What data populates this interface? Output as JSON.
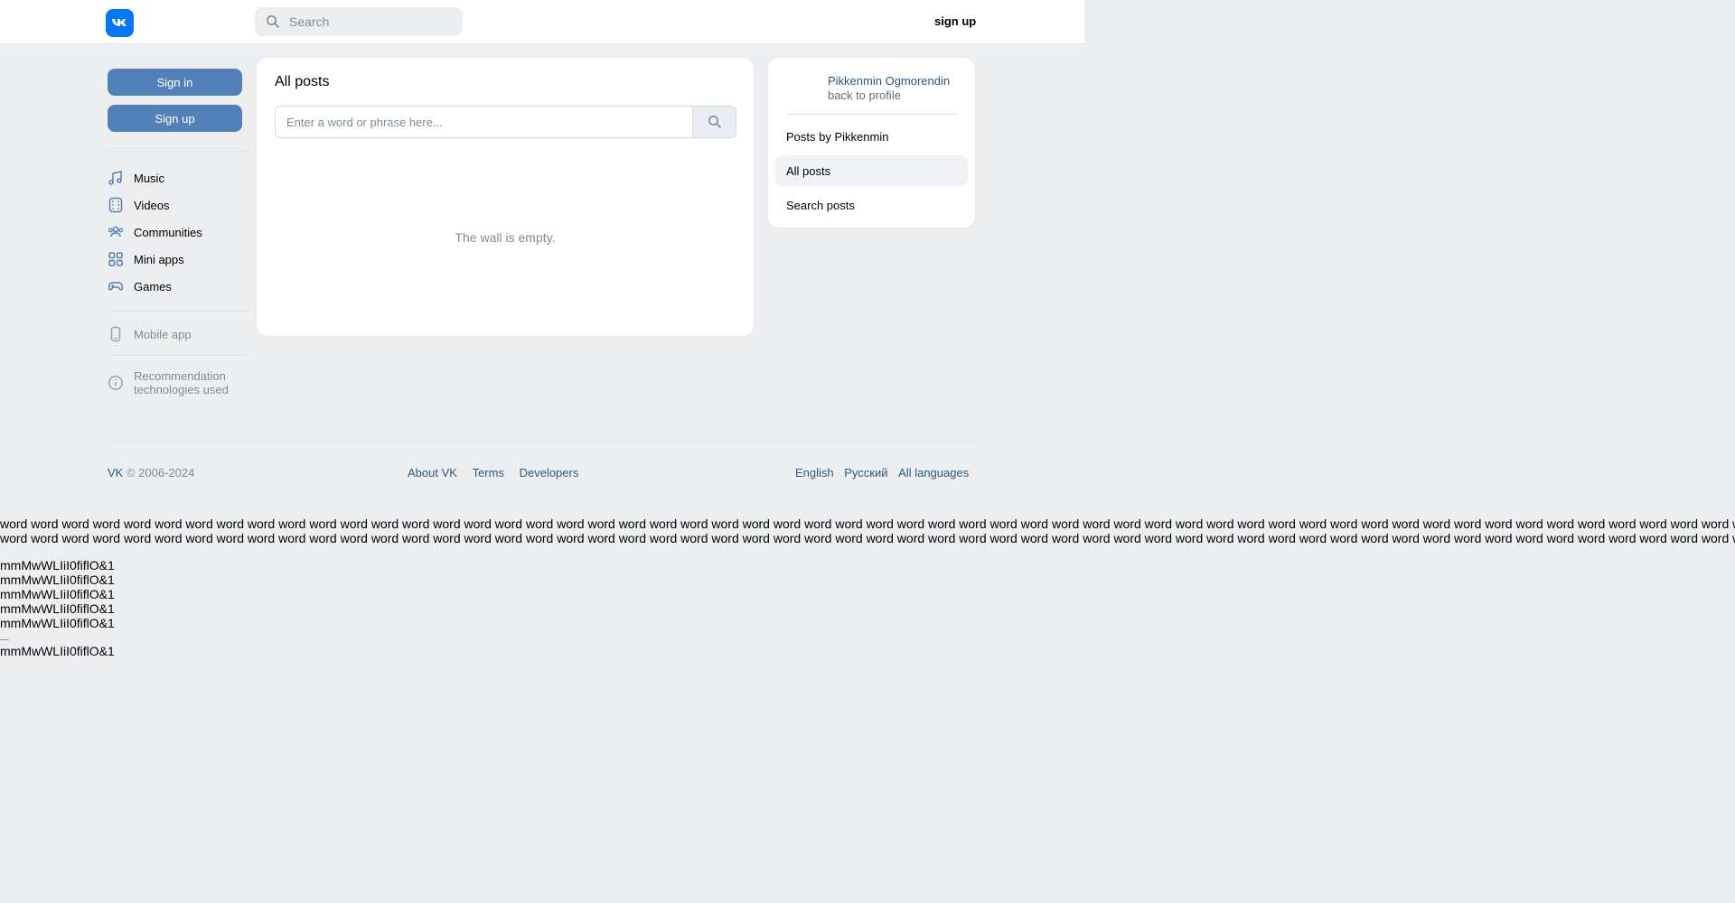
{
  "header": {
    "search_placeholder": "Search",
    "signup_label": "sign up"
  },
  "left": {
    "signin_label": "Sign in",
    "signup_label": "Sign up",
    "nav": [
      {
        "label": "Music",
        "icon": "music-icon"
      },
      {
        "label": "Videos",
        "icon": "video-icon"
      },
      {
        "label": "Communities",
        "icon": "communities-icon"
      },
      {
        "label": "Mini apps",
        "icon": "mini-apps-icon"
      },
      {
        "label": "Games",
        "icon": "gamepad-icon"
      }
    ],
    "mobile_app": "Mobile app",
    "recommendation_line1": "Recommendation",
    "recommendation_line2": "technologies used"
  },
  "main": {
    "title": "All posts",
    "search_placeholder": "Enter a word or phrase here...",
    "empty_text": "The wall is empty."
  },
  "side": {
    "owner_name": "Pikkenmin Ogmorendin",
    "owner_sub": "back to profile",
    "items": [
      {
        "label": "Posts by Pikkenmin",
        "active": false
      },
      {
        "label": "All posts",
        "active": true
      },
      {
        "label": "Search posts",
        "active": false
      }
    ]
  },
  "footer": {
    "copyright_brand": "VK",
    "copyright_years": "© 2006-2024",
    "links": [
      "About VK",
      "Terms",
      "Developers"
    ],
    "languages": [
      "English",
      "Русский",
      "All languages"
    ]
  },
  "test_text": {
    "words_line": "word word word word word word word word word word word word word word word word word word word word word word word word word word word word word word word word word word word word word word word word word word word word word word word word word word word word word word word word word word word word word word word word word word word word word",
    "glyph_line": "mmMwWLIiI0fiflO&1"
  },
  "colors": {
    "brand": "#0077ff",
    "button": "#5181b8",
    "link": "#2a5885",
    "muted": "#818c99",
    "background": "#edeef0"
  }
}
